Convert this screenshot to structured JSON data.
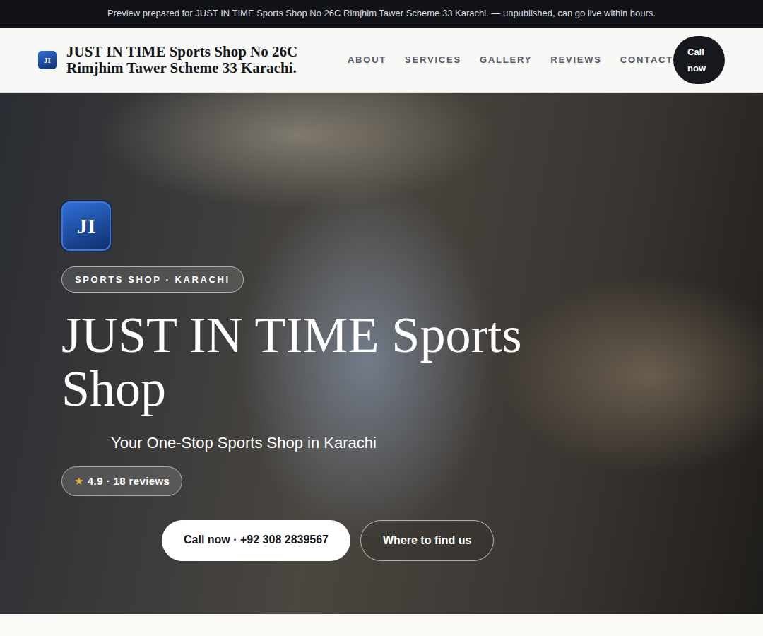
{
  "banner": "Preview prepared for JUST IN TIME Sports Shop No 26C Rimjhim Tawer Scheme 33 Karachi. — unpublished, can go live within hours.",
  "header": {
    "logo": "JI",
    "title": "JUST IN TIME Sports Shop No 26C Rimjhim Tawer Scheme 33 Karachi.",
    "nav": [
      "ABOUT",
      "SERVICES",
      "GALLERY",
      "REVIEWS",
      "CONTACT"
    ],
    "cta": "Call now"
  },
  "hero": {
    "logo": "JI",
    "tag": "SPORTS SHOP · KARACHI",
    "title": "JUST IN TIME Sports Shop",
    "subtitle": "Your One-Stop Sports Shop in Karachi",
    "rating": {
      "star": "★",
      "text": "4.9 · 18 reviews"
    },
    "buttons": [
      "Call now · +92 308 2839567",
      "Where to find us"
    ]
  }
}
